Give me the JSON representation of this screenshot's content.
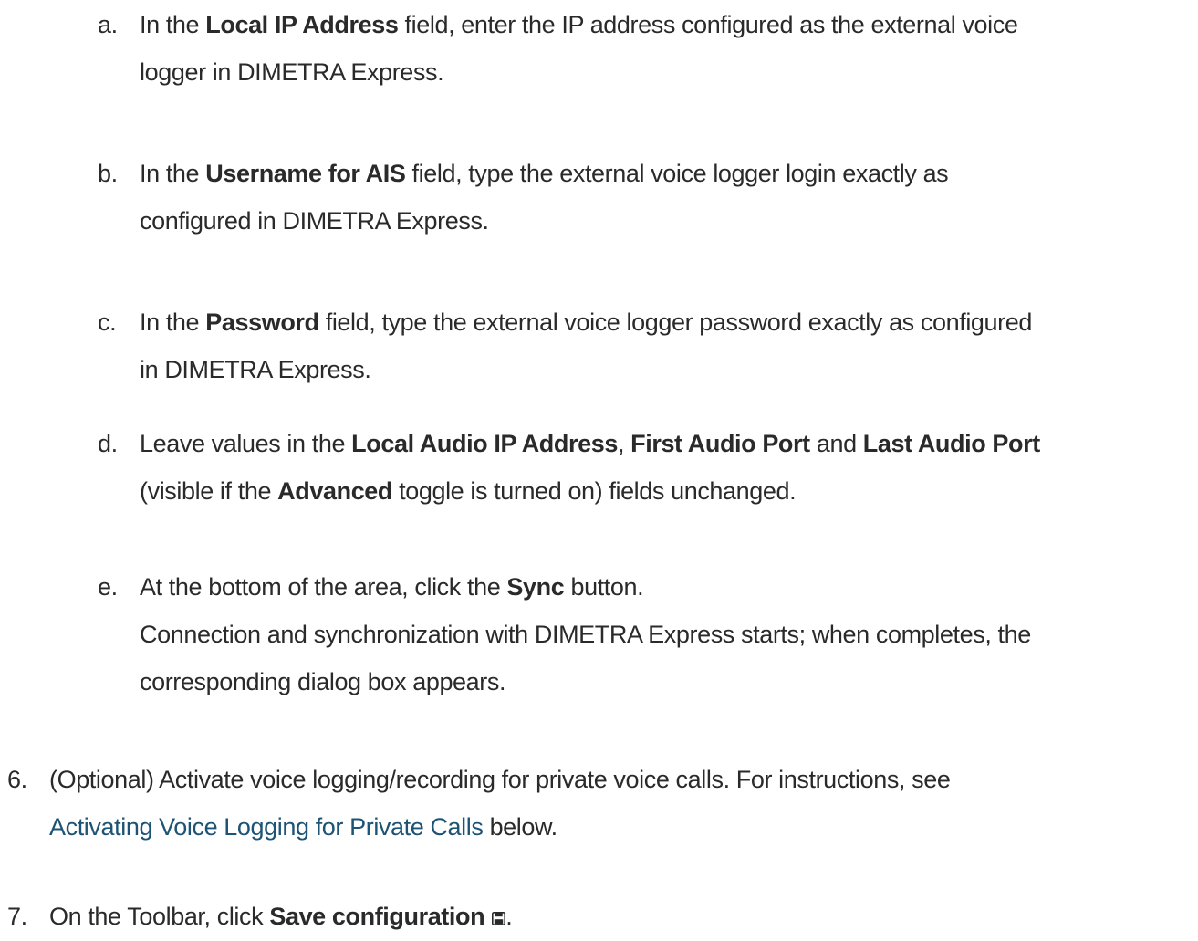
{
  "substeps": [
    {
      "marker": "a.",
      "lines": [
        [
          {
            "t": "In the ",
            "b": false
          },
          {
            "t": "Local IP Address",
            "b": true
          },
          {
            "t": " field, enter the IP address configured as the external voice",
            "b": false
          }
        ],
        [
          {
            "t": "logger in DIMETRA Express.",
            "b": false
          }
        ]
      ]
    },
    {
      "marker": "b.",
      "lines": [
        [
          {
            "t": "In the ",
            "b": false
          },
          {
            "t": "Username for AIS",
            "b": true
          },
          {
            "t": " field, type the external voice logger login exactly as",
            "b": false
          }
        ],
        [
          {
            "t": "configured in DIMETRA Express.",
            "b": false
          }
        ]
      ]
    },
    {
      "marker": "c.",
      "lines": [
        [
          {
            "t": "In the ",
            "b": false
          },
          {
            "t": "Password",
            "b": true
          },
          {
            "t": " field, type the external voice logger password exactly as configured",
            "b": false
          }
        ],
        [
          {
            "t": "in DIMETRA Express.",
            "b": false
          }
        ]
      ]
    },
    {
      "marker": "d.",
      "lines": [
        [
          {
            "t": "Leave values in the ",
            "b": false
          },
          {
            "t": "Local Audio IP Address",
            "b": true
          },
          {
            "t": ", ",
            "b": false
          },
          {
            "t": "First Audio Port",
            "b": true
          },
          {
            "t": " and ",
            "b": false
          },
          {
            "t": "Last Audio Port",
            "b": true
          }
        ],
        [
          {
            "t": "(visible if the ",
            "b": false
          },
          {
            "t": "Advanced",
            "b": true
          },
          {
            "t": " toggle is turned on) fields unchanged.",
            "b": false
          }
        ]
      ]
    },
    {
      "marker": "e.",
      "lines": [
        [
          {
            "t": "At the bottom of the area, click the ",
            "b": false
          },
          {
            "t": "Sync",
            "b": true
          },
          {
            "t": " button.",
            "b": false
          }
        ],
        [
          {
            "t": "Connection and synchronization with DIMETRA Express starts; when completes, the",
            "b": false
          }
        ],
        [
          {
            "t": "corresponding dialog box appears.",
            "b": false
          }
        ]
      ]
    }
  ],
  "step6": {
    "marker": "6.",
    "line1": "(Optional) Activate voice logging/recording for private voice calls. For instructions, see",
    "link_text": "Activating Voice Logging for Private Calls",
    "after_link": " below."
  },
  "step7": {
    "marker": "7.",
    "prefix": "On the Toolbar, click ",
    "bold": "Save configuration",
    "icon": "save-icon",
    "suffix": "."
  },
  "colors": {
    "text": "#2a2a2a",
    "link": "#1d5375"
  }
}
